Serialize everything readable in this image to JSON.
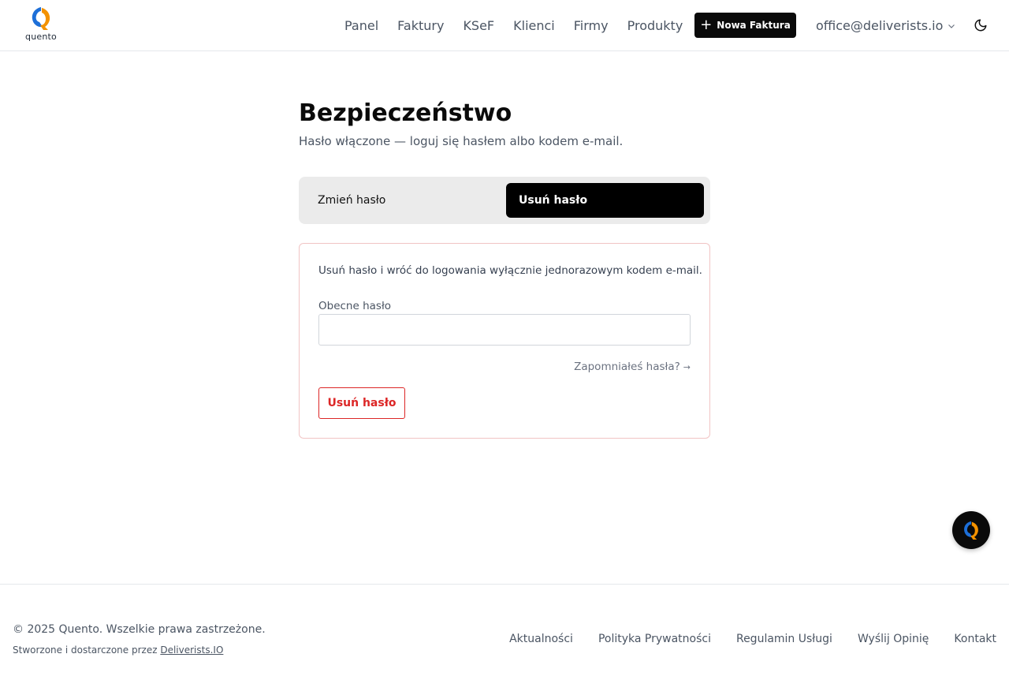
{
  "header": {
    "logo_text": "quento",
    "nav": [
      {
        "label": "Panel"
      },
      {
        "label": "Faktury"
      },
      {
        "label": "KSeF"
      },
      {
        "label": "Klienci"
      },
      {
        "label": "Firmy"
      },
      {
        "label": "Produkty"
      }
    ],
    "new_invoice_label": "Nowa Faktura",
    "account_email": "office@deliverists.io",
    "icons": {
      "theme": "moon-icon",
      "account_menu": "chevron-down-icon",
      "new_invoice": "plus-icon"
    }
  },
  "main": {
    "title": "Bezpieczeństwo",
    "subtitle": "Hasło włączone — loguj się hasłem albo kodem e-mail.",
    "tabs": [
      {
        "label": "Zmień hasło",
        "active": false
      },
      {
        "label": "Usuń hasło",
        "active": true
      }
    ],
    "card": {
      "description": "Usuń hasło i wróć do logowania wyłącznie jednorazowym kodem e-mail.",
      "field_label": "Obecne hasło",
      "field_value": "",
      "forgot_label": "Zapomniałeś hasła?",
      "forgot_arrow": "→",
      "submit_label": "Usuń hasło"
    }
  },
  "footer": {
    "copyright": "© 2025 Quento. Wszelkie prawa zastrzeżone.",
    "credits_prefix": "Stworzone i dostarczone przez",
    "credits_link": "Deliverists.IO",
    "links": [
      {
        "label": "Aktualności"
      },
      {
        "label": "Polityka Prywatności"
      },
      {
        "label": "Regulamin Usługi"
      },
      {
        "label": "Wyślij Opinię"
      },
      {
        "label": "Kontakt"
      }
    ]
  },
  "colors": {
    "accent": "#0a0a0a",
    "danger": "#dc2626",
    "logo_blue": "#1d6fd8",
    "logo_orange": "#f39200"
  }
}
